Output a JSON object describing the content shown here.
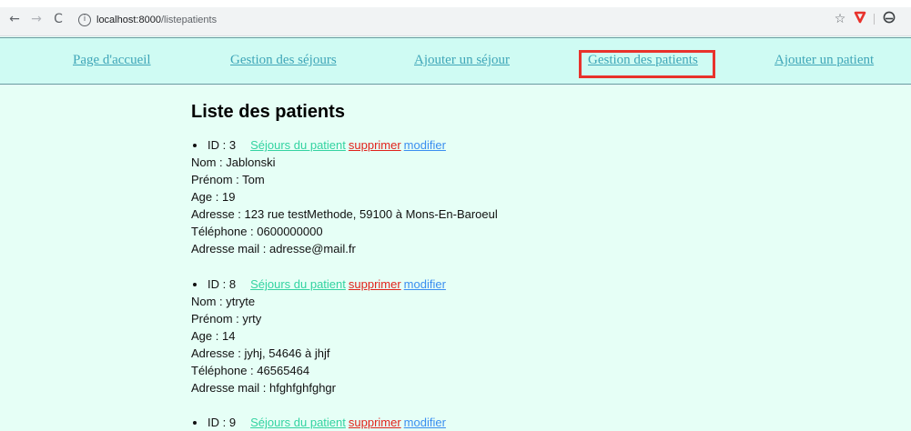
{
  "browser": {
    "url_host": "localhost:8000",
    "url_path": "/listepatients",
    "icons": [
      "back-icon",
      "forward-icon",
      "reload-icon",
      "info-icon",
      "star-icon",
      "shield-icon",
      "profile-icon"
    ]
  },
  "nav": {
    "home": "Page d'accueil",
    "stays": "Gestion des séjours",
    "add_stay": "Ajouter un séjour",
    "patients": "Gestion des patients",
    "add_patient": "Ajouter un patient"
  },
  "page": {
    "title": "Liste des patients"
  },
  "patients": [
    {
      "id_label": "ID : 3",
      "sejours": "Séjours du patient",
      "supprimer": "supprimer",
      "modifier": "modifier",
      "nom": "Nom : Jablonski",
      "prenom": "Prénom : Tom",
      "age": "Age : 19",
      "adresse": "Adresse : 123 rue testMethode, 59100 à Mons-En-Baroeul",
      "telephone": "Téléphone : 0600000000",
      "mail": "Adresse mail : adresse@mail.fr"
    },
    {
      "id_label": "ID : 8",
      "sejours": "Séjours du patient",
      "supprimer": "supprimer",
      "modifier": "modifier",
      "nom": "Nom : ytryte",
      "prenom": "Prénom : yrty",
      "age": "Age : 14",
      "adresse": "Adresse : jyhj, 54646 à jhjf",
      "telephone": "Téléphone : 46565464",
      "mail": "Adresse mail : hfghfghfghgr"
    },
    {
      "id_label": "ID : 9",
      "sejours": "Séjours du patient",
      "supprimer": "supprimer",
      "modifier": "modifier"
    }
  ],
  "colors": {
    "page_bg": "#e6fff6",
    "nav_bg": "#cffbf3",
    "nav_link": "#3fa6b8",
    "highlight": "#e8322c",
    "sejours_link": "#33d3a1",
    "supprimer_link": "#e1221b",
    "modifier_link": "#3a8ef0"
  }
}
